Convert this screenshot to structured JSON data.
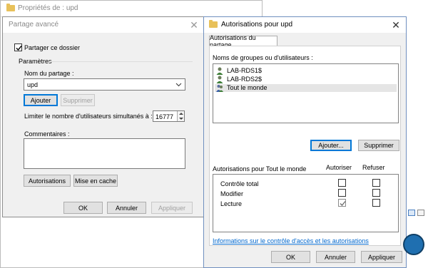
{
  "background_window": {
    "title": "Propriétés de : upd"
  },
  "advanced_share": {
    "title": "Partage avancé",
    "share_checkbox_label": "Partager ce dossier",
    "share_checked": true,
    "params_label": "Paramètres",
    "share_name_label": "Nom du partage :",
    "share_name_value": "upd",
    "add_label": "Ajouter",
    "remove_label": "Supprimer",
    "limit_label": "Limiter le nombre d'utilisateurs simultanés à :",
    "limit_value": "16777",
    "comments_label": "Commentaires :",
    "comments_value": "",
    "permissions_label": "Autorisations",
    "caching_label": "Mise en cache",
    "ok_label": "OK",
    "cancel_label": "Annuler",
    "apply_label": "Appliquer"
  },
  "permissions_dialog": {
    "title": "Autorisations pour upd",
    "tab_label": "Autorisations du partage",
    "groups_label": "Noms de groupes ou d'utilisateurs :",
    "users": [
      {
        "name": "LAB-RDS1$",
        "selected": false
      },
      {
        "name": "LAB-RDS2$",
        "selected": false
      },
      {
        "name": "Tout le monde",
        "selected": true
      }
    ],
    "add_label": "Ajouter...",
    "remove_label": "Supprimer",
    "perm_for_label": "Autorisations pour Tout le monde",
    "allow_header": "Autoriser",
    "deny_header": "Refuser",
    "permissions": [
      {
        "name": "Contrôle total",
        "allow": false,
        "deny": false
      },
      {
        "name": "Modifier",
        "allow": false,
        "deny": false
      },
      {
        "name": "Lecture",
        "allow": true,
        "deny": false
      }
    ],
    "info_link": "Informations sur le contrôle d'accès et les autorisations",
    "ok_label": "OK",
    "cancel_label": "Annuler",
    "apply_label": "Appliquer"
  },
  "colors": {
    "accent": "#0078d7",
    "link": "#0066cc",
    "folder": "#e8c15a"
  }
}
